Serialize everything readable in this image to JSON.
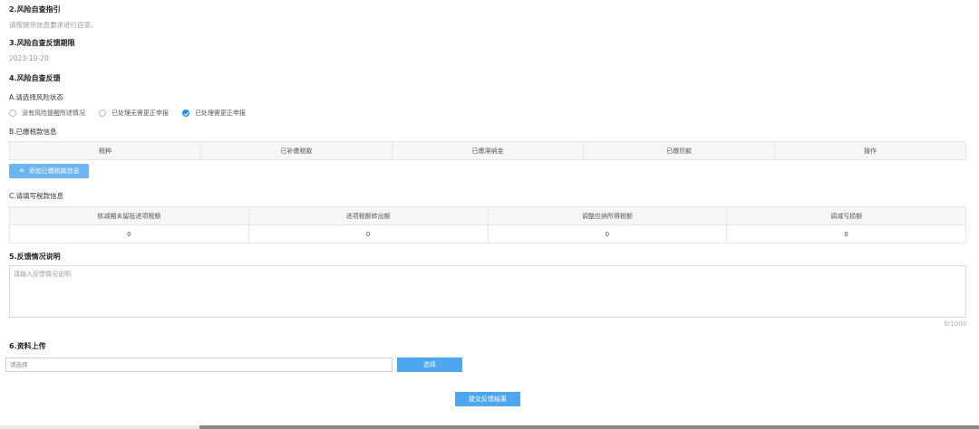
{
  "sections": {
    "guide": {
      "title": "2.风险自查指引",
      "text": "请按提示信息要求进行自查。"
    },
    "deadline": {
      "title": "3.风险自查反馈期限",
      "date": "2023-10-20"
    },
    "feedback": {
      "title": "4.风险自查反馈",
      "status_label": "A.请选择风险状态",
      "options": [
        {
          "label": "没有风险提醒所述情况",
          "checked": false
        },
        {
          "label": "已处理无需更正申报",
          "checked": false
        },
        {
          "label": "已处理需更正申报",
          "checked": true
        }
      ]
    },
    "paid_tax": {
      "label": "B.已缴税款信息",
      "columns": [
        "税种",
        "已补缴税款",
        "已缴滞纳金",
        "已缴罚款",
        "操作"
      ],
      "add_button": "添加已缴税款信息"
    },
    "loss_info": {
      "label": "C.请填写税款信息",
      "columns": [
        "核减期末留抵进项税额",
        "进项税额转出额",
        "调整应纳所得税额",
        "调减亏损额"
      ],
      "row": [
        "0",
        "0",
        "0",
        "0"
      ]
    },
    "explanation": {
      "title": "5.反馈情况说明",
      "placeholder": "请输入反馈情况说明",
      "counter": "0/1000"
    },
    "upload": {
      "title": "6.资料上传",
      "placeholder": "请选择",
      "choose_button": "选择"
    }
  },
  "submit_button": "提交反馈结果",
  "colors": {
    "primary": "#4ca6f0",
    "radio_checked": "#1890ff",
    "header_bg": "#f5f6f8"
  }
}
